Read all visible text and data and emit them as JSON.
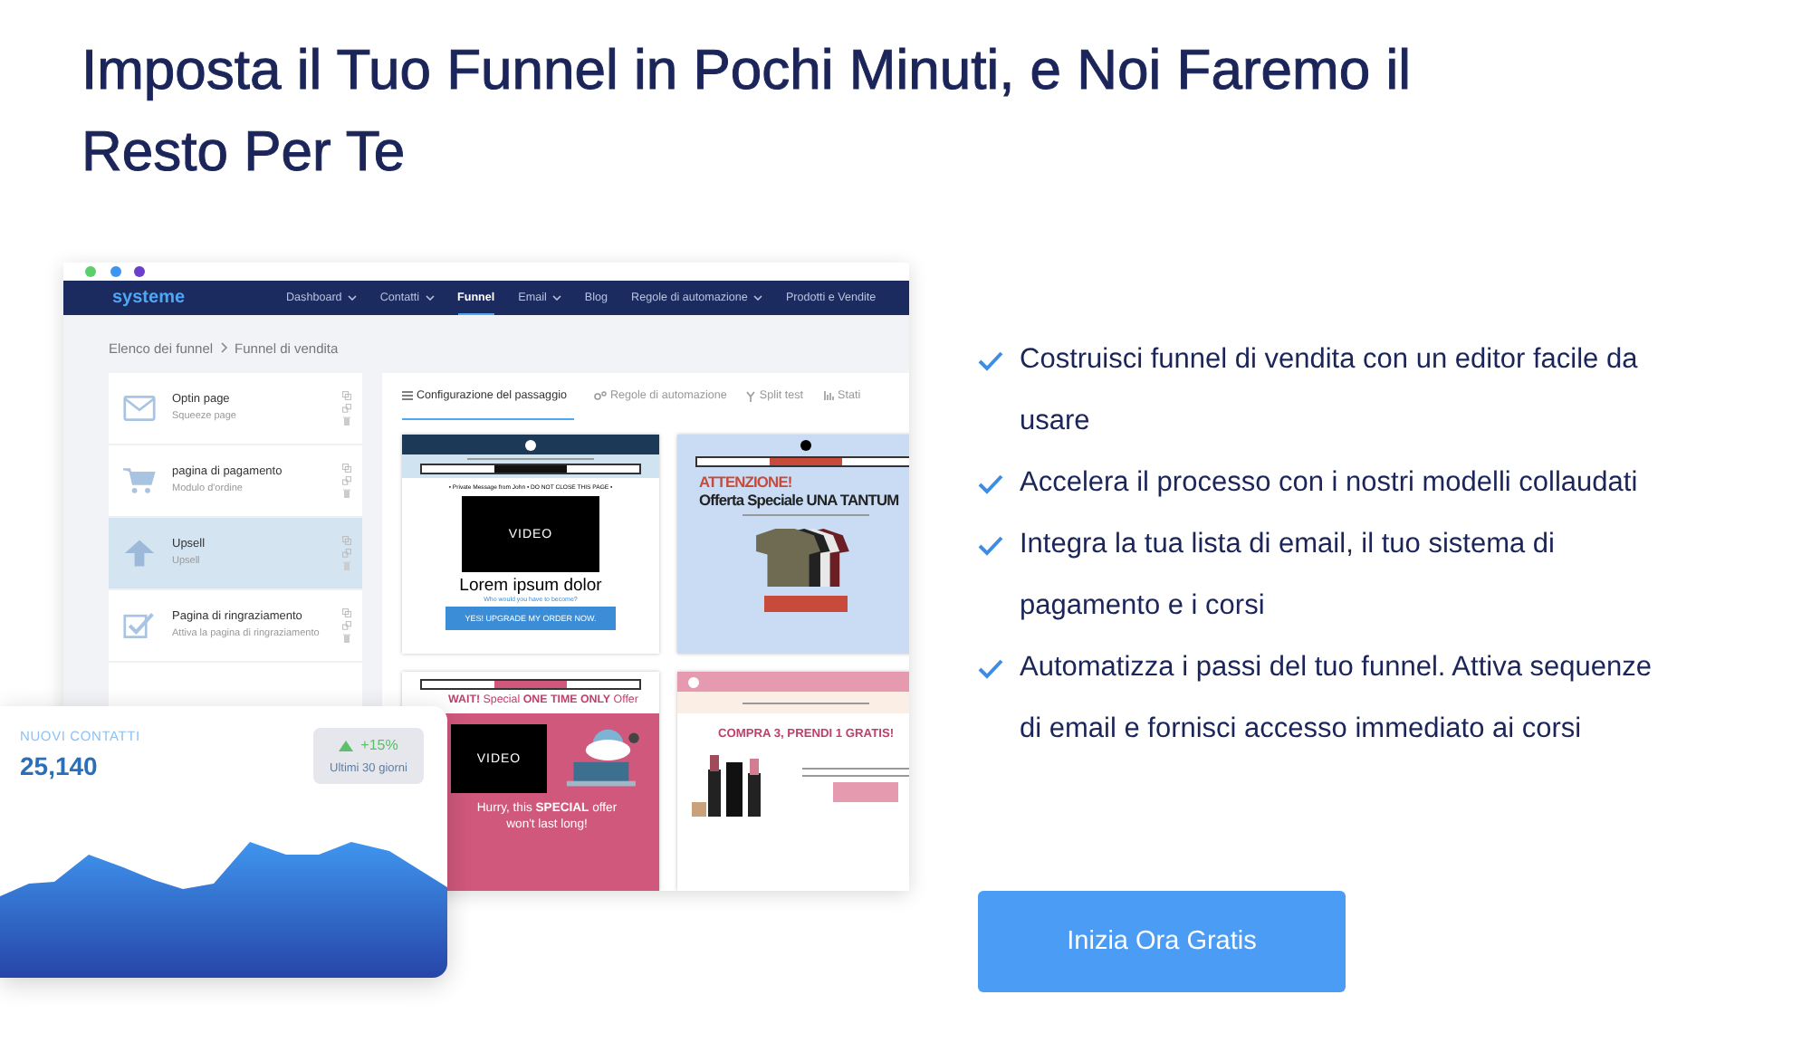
{
  "heading": "Imposta il Tuo Funnel in Pochi Minuti, e Noi Faremo il Resto Per Te",
  "mockup": {
    "logo": "systeme",
    "nav": [
      {
        "label": "Dashboard",
        "dropdown": true,
        "selected": false
      },
      {
        "label": "Contatti",
        "dropdown": true,
        "selected": false
      },
      {
        "label": "Funnel",
        "dropdown": false,
        "selected": true
      },
      {
        "label": "Email",
        "dropdown": true,
        "selected": false
      },
      {
        "label": "Blog",
        "dropdown": false,
        "selected": false
      },
      {
        "label": "Regole di automazione",
        "dropdown": true,
        "selected": false
      },
      {
        "label": "Prodotti e Vendite",
        "dropdown": false,
        "selected": false
      }
    ],
    "breadcrumb": [
      "Elenco dei funnel",
      "Funnel di vendita"
    ],
    "steps": [
      {
        "name": "Optin page",
        "subtitle": "Squeeze page",
        "kind": "email",
        "selected": false
      },
      {
        "name": "pagina di pagamento",
        "subtitle": "Modulo d'ordine",
        "kind": "cart",
        "selected": false
      },
      {
        "name": "Upsell",
        "subtitle": "Upsell",
        "kind": "upsell",
        "selected": true
      },
      {
        "name": "Pagina di ringraziamento",
        "subtitle": "Attiva la pagina di ringraziamento",
        "kind": "thanks",
        "selected": false
      }
    ],
    "tabs": [
      {
        "label": "Configurazione del passaggio",
        "kind": "list",
        "selected": true
      },
      {
        "label": "Regole di automazione",
        "kind": "automation",
        "selected": false
      },
      {
        "label": "Split test",
        "kind": "split",
        "selected": false
      },
      {
        "label": "Stati",
        "kind": "stats",
        "selected": false
      }
    ],
    "previews": [
      {
        "kind": "video-upsell",
        "notice": "• Private Message from John • DO NOT CLOSE THIS PAGE •",
        "video": "VIDEO",
        "title": "Lorem ipsum dolor",
        "subtitle": "Who would you have to become?",
        "button": "YES! UPGRADE MY ORDER NOW."
      },
      {
        "kind": "product-offer",
        "alert": "ATTENZIONE!",
        "title": "Offerta Speciale UNA TANTUM"
      },
      {
        "kind": "video-offer",
        "title": "**WAIT!** Special **ONE TIME ONLY** Offer",
        "video": "VIDEO",
        "subtitle": "Hurry, this **SPECIAL** offer won't last long!"
      },
      {
        "kind": "bundle-offer",
        "title": "COMPRA 3, PRENDI 1 GRATIS!"
      }
    ]
  },
  "stats_card": {
    "label": "NUOVI CONTATTI",
    "value": "25,140",
    "change": "+15%",
    "period": "Ultimi 30 giorni"
  },
  "features": [
    "Costruisci funnel di vendita con un editor facile da usare",
    "Accelera il processo con i nostri modelli collaudati",
    "Integra la tua lista di email, il tuo sistema di pagamento e i corsi",
    "Automatizza i passi del tuo funnel. Attiva sequenze di email e fornisci accesso immediato ai corsi"
  ],
  "cta": "Inizia Ora Gratis"
}
